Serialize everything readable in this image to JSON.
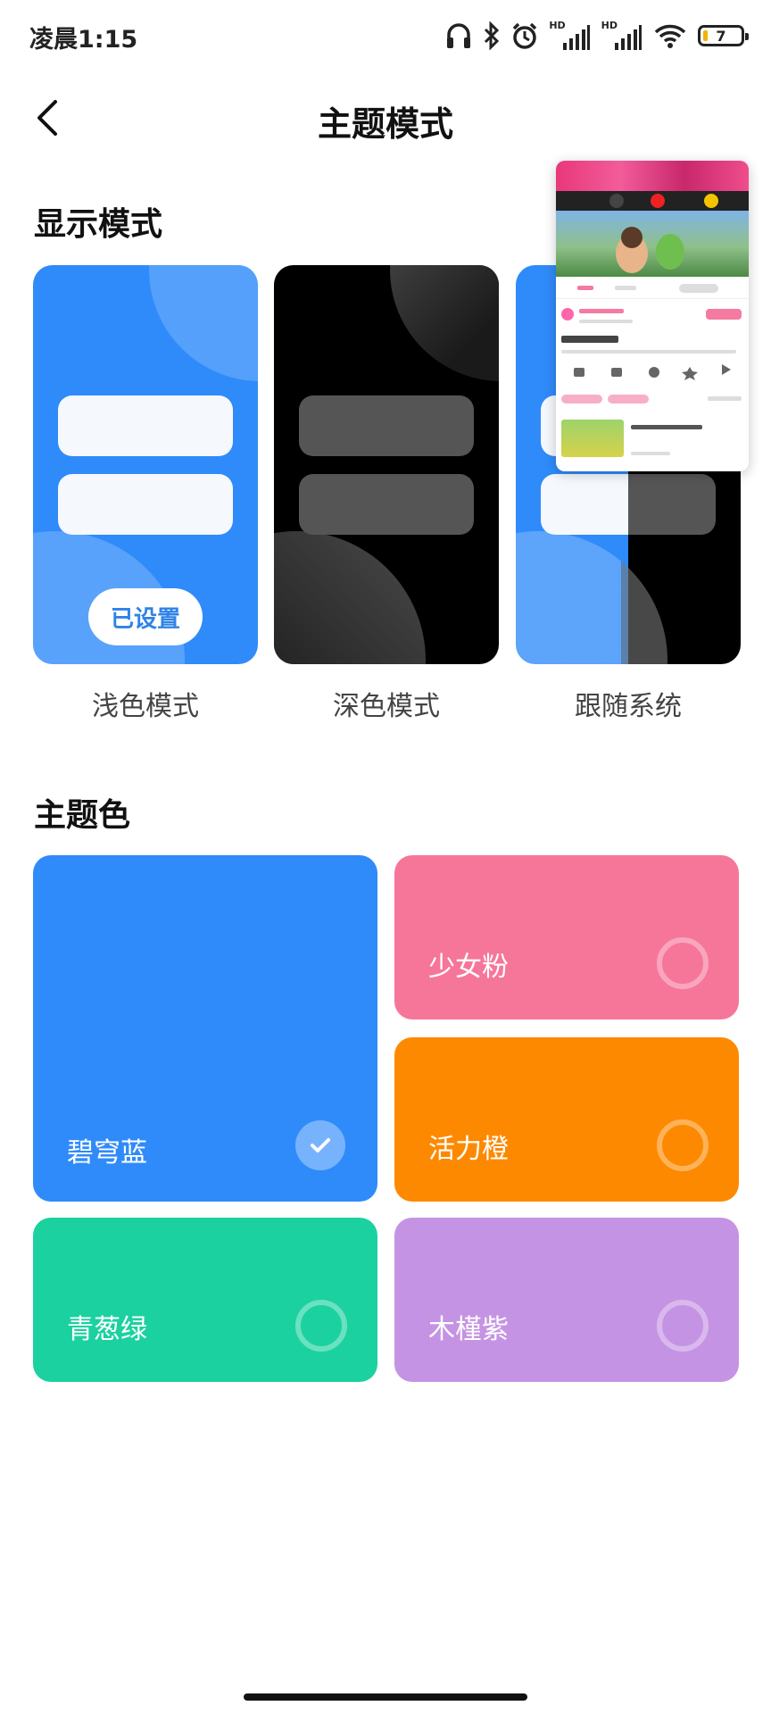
{
  "status_bar": {
    "time": "凌晨1:15",
    "hd1": "HD",
    "hd2": "HD",
    "battery": "7"
  },
  "header": {
    "title": "主题模式"
  },
  "display_mode": {
    "title": "显示模式",
    "set_badge": "已设置",
    "options": [
      {
        "label": "浅色模式"
      },
      {
        "label": "深色模式"
      },
      {
        "label": "跟随系统"
      }
    ]
  },
  "theme_color": {
    "title": "主题色",
    "options": [
      {
        "label": "碧穹蓝",
        "color": "#2f8bfa",
        "selected": true
      },
      {
        "label": "少女粉",
        "color": "#f6769a",
        "selected": false
      },
      {
        "label": "活力橙",
        "color": "#fd8901",
        "selected": false
      },
      {
        "label": "青葱绿",
        "color": "#1bd1a0",
        "selected": false
      },
      {
        "label": "木槿紫",
        "color": "#c593e3",
        "selected": false
      }
    ]
  },
  "colors": {
    "accent": "#2f8bfa"
  }
}
